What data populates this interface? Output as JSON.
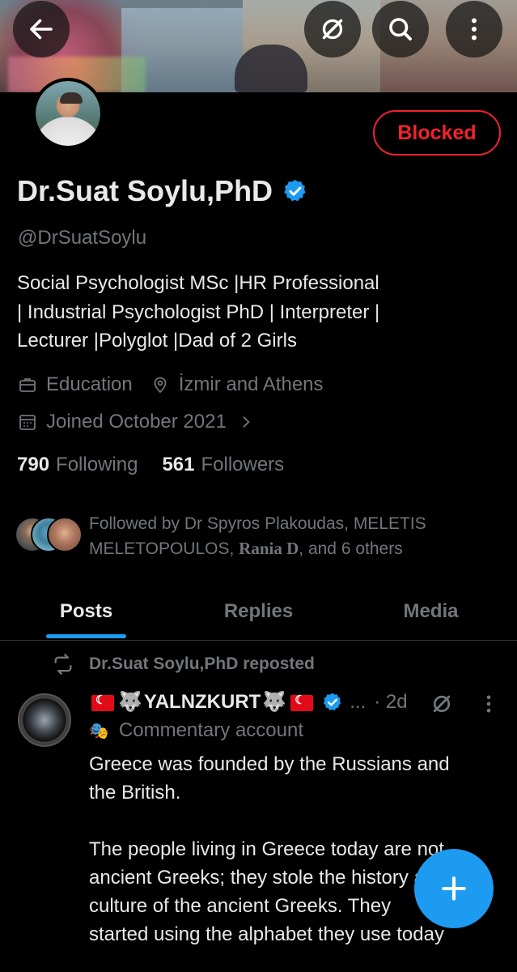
{
  "profile": {
    "name": "Dr.Suat Soylu,PhD",
    "handle": "@DrSuatSoylu",
    "blocked_label": "Blocked",
    "bio_lines": [
      "Social Psychologist MSc |HR Professional",
      "| Industrial Psychologist PhD | Interpreter |",
      "Lecturer |Polyglot |Dad of 2 Girls"
    ],
    "category": "Education",
    "location": "İzmir and Athens",
    "joined": "Joined October 2021",
    "following_count": "790",
    "following_label": "Following",
    "followers_count": "561",
    "followers_label": "Followers",
    "followed_by": {
      "prefix": "Followed by Dr Spyros Plakoudas, MELETIS",
      "line2_start": "MELETOPOULOS, ",
      "styled_name": "Rania D",
      "suffix": ", and 6 others"
    }
  },
  "tabs": [
    {
      "label": "Posts",
      "active": true
    },
    {
      "label": "Replies",
      "active": false
    },
    {
      "label": "Media",
      "active": false
    }
  ],
  "post": {
    "repost_text": "Dr.Suat Soylu,PhD reposted",
    "author_name": "YALNZKURT",
    "ellipsis": "...",
    "time": "· 2d",
    "subtitle": "Commentary account",
    "text_lines": [
      "Greece was founded by the Russians and",
      "the British.",
      "",
      "The people living in Greece today are not",
      "ancient Greeks; they stole the history and",
      "culture of the ancient Greeks. They",
      "started using the alphabet they use today"
    ]
  },
  "icons": {
    "back": "arrow-left-icon",
    "grok": "grok-icon",
    "search": "search-icon",
    "more": "more-vertical-icon",
    "verified": "verified-badge-icon",
    "category": "briefcase-icon",
    "location": "location-pin-icon",
    "calendar": "calendar-icon",
    "repost": "repost-icon",
    "compose": "plus-icon"
  },
  "colors": {
    "accent": "#1d9bf0",
    "blocked": "#f4212e",
    "secondary_text": "#71767b",
    "primary_text": "#e7e9ea"
  }
}
